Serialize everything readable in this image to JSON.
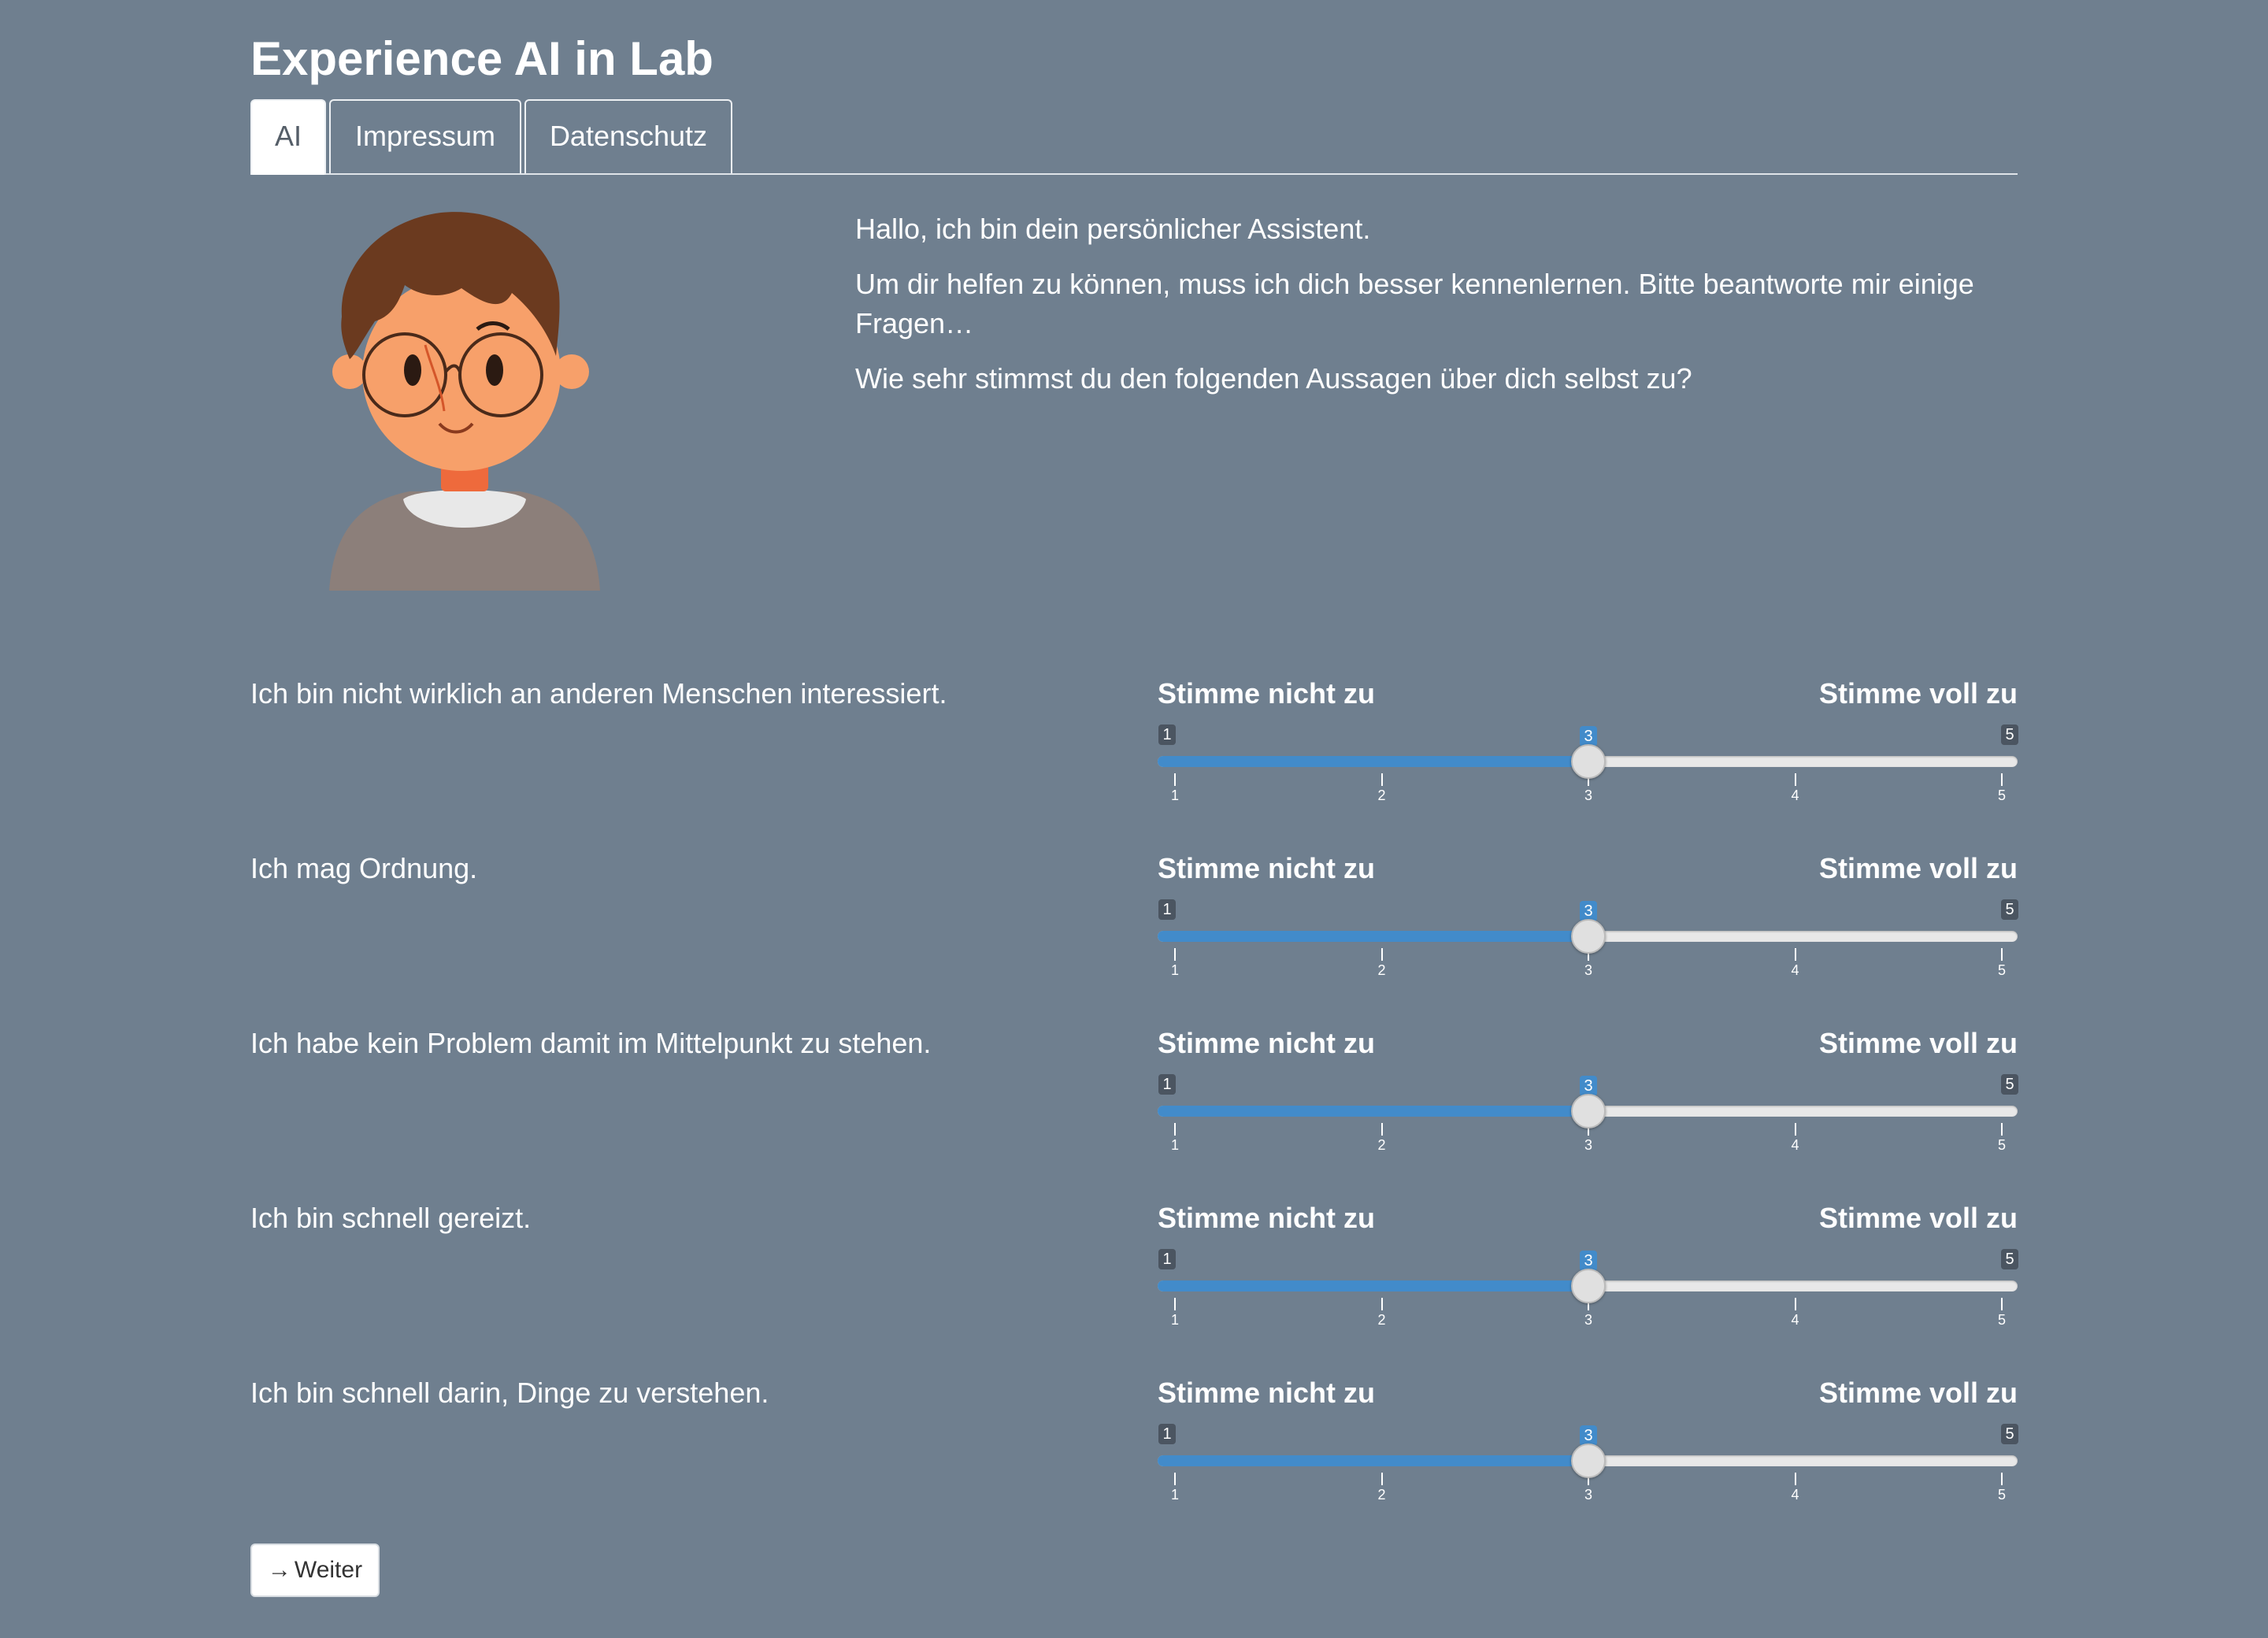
{
  "app_title": "Experience AI in Lab",
  "tabs": [
    {
      "label": "AI",
      "active": true
    },
    {
      "label": "Impressum",
      "active": false
    },
    {
      "label": "Datenschutz",
      "active": false
    }
  ],
  "intro": {
    "greeting": "Hallo, ich bin dein persönlicher Assistent.",
    "help": "Um dir helfen zu können, muss ich dich besser kennenlernen. Bitte beantworte mir einige Fragen…",
    "question": "Wie sehr stimmst du den folgenden Aussagen über dich selbst zu?"
  },
  "scale": {
    "left_label": "Stimme nicht zu",
    "right_label": "Stimme voll zu",
    "min": "1",
    "max": "5",
    "ticks": [
      "1",
      "2",
      "3",
      "4",
      "5"
    ]
  },
  "items": [
    {
      "statement": "Ich bin nicht wirklich an anderen Menschen interessiert.",
      "value": "3"
    },
    {
      "statement": "Ich mag Ordnung.",
      "value": "3"
    },
    {
      "statement": "Ich habe kein Problem damit im Mittelpunkt zu stehen.",
      "value": "3"
    },
    {
      "statement": "Ich bin schnell gereizt.",
      "value": "3"
    },
    {
      "statement": "Ich bin schnell darin, Dinge zu verstehen.",
      "value": "3"
    }
  ],
  "next_button": {
    "label": "Weiter",
    "icon": "arrow-right-icon"
  },
  "colors": {
    "background": "#6f7f8f",
    "accent": "#428bca"
  }
}
